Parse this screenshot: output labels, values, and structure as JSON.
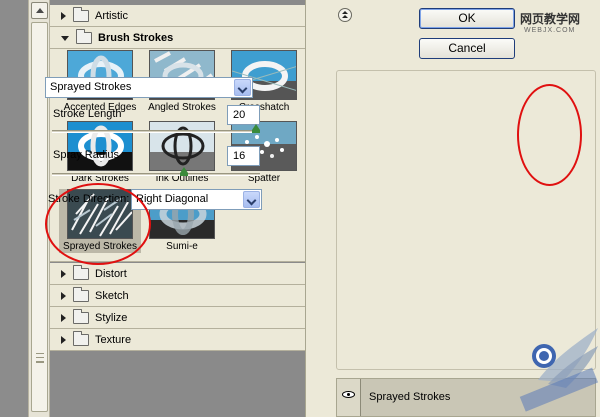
{
  "filter_tree": {
    "categories_top": [
      {
        "label": "Artistic",
        "expanded": false
      }
    ],
    "brush_strokes": {
      "label": "Brush Strokes",
      "expanded": true,
      "thumbnails": [
        {
          "label": "Accented Edges"
        },
        {
          "label": "Angled Strokes"
        },
        {
          "label": "Crosshatch"
        },
        {
          "label": "Dark Strokes"
        },
        {
          "label": "Ink Outlines"
        },
        {
          "label": "Spatter"
        },
        {
          "label": "Sprayed Strokes",
          "selected": true
        },
        {
          "label": "Sumi-e"
        }
      ]
    },
    "categories_bottom": [
      {
        "label": "Distort"
      },
      {
        "label": "Sketch"
      },
      {
        "label": "Stylize"
      },
      {
        "label": "Texture"
      }
    ]
  },
  "dialog": {
    "ok_label": "OK",
    "cancel_label": "Cancel",
    "filter_select": "Sprayed Strokes",
    "stroke_length": {
      "label": "Stroke Length",
      "value": "20",
      "slider_fraction": 1.0
    },
    "spray_radius": {
      "label": "Spray Radius",
      "value": "16",
      "slider_fraction": 0.64
    },
    "stroke_direction": {
      "label": "Stroke Direction:",
      "value": "Right Diagonal"
    }
  },
  "layers": {
    "active_layer": "Sprayed Strokes"
  },
  "watermark": {
    "site_name": "网页教学网",
    "site_url": "WEBJX.COM"
  },
  "colors": {
    "annotation": "#e01010",
    "panel_bg": "#ece9d8",
    "slider_thumb": "#3a8a3a"
  }
}
